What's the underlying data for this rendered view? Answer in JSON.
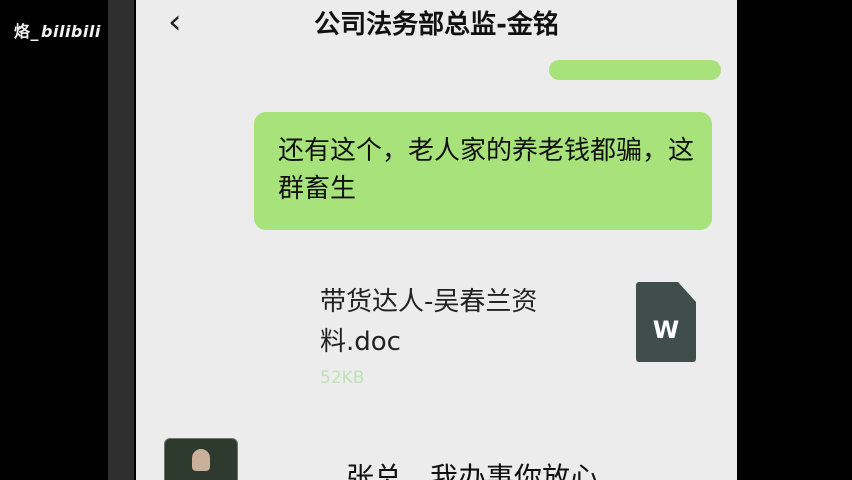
{
  "watermark": {
    "prefix": "烙_",
    "brand": "bilibili"
  },
  "header": {
    "back_glyph": "‹",
    "title": "公司法务部总监-金铭"
  },
  "messages": {
    "outgoing_text": "还有这个，老人家的养老钱都骗，这群畜生"
  },
  "file": {
    "name": "带货达人-吴春兰资料.doc",
    "size": "52KB",
    "type_letter": "W",
    "icon": "word-doc-icon"
  },
  "next_message": {
    "prefix": "、",
    "text": "张总，我办事你放心"
  },
  "colors": {
    "bubble": "#a7e27a",
    "background": "#ececec",
    "doc_icon": "#3f4d4b"
  }
}
